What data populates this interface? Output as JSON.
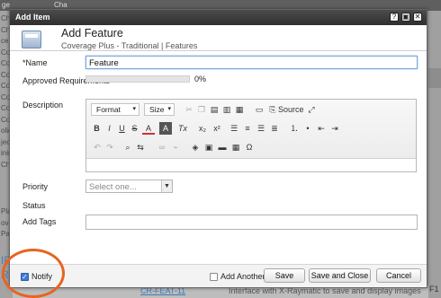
{
  "background": {
    "topbar_texts": [
      "ge",
      "Cha"
    ],
    "left_items": [
      "Cha",
      "Cha",
      "centt",
      "Cov",
      "Cov",
      "Cov",
      "Cov",
      "Cov",
      "Cov",
      "Cov",
      "olica",
      "ject",
      "inin",
      "Cha"
    ],
    "left_items_lower": [
      "Plan",
      "overa",
      "Pali"
    ],
    "left_blue": [
      "IP",
      "RF"
    ],
    "right_num": "F1",
    "bottom_link": "CR-FEAT-11",
    "bottom_text": "Interface with X-Raymatic to save and display images"
  },
  "dialog": {
    "window_title": "Add Item",
    "window_buttons": [
      "?",
      "▣",
      "✕"
    ],
    "title": "Add Feature",
    "subtitle": "Coverage Plus - Traditional | Features"
  },
  "form": {
    "name_label": "*Name",
    "name_value": "Feature",
    "approved_label": "Approved Requirements",
    "approved_value_text": "0%",
    "approved_fraction": 0,
    "description_label": "Description",
    "priority_label": "Priority",
    "priority_placeholder": "Select one...",
    "status_label": "Status",
    "tags_label": "Add Tags",
    "tags_value": ""
  },
  "editor": {
    "format_label": "Format",
    "size_label": "Size",
    "source_label": "Source",
    "row2": [
      "B",
      "I",
      "U",
      "S",
      "A",
      "A",
      "Tx"
    ],
    "subscript": "x₂",
    "superscript": "x²",
    "icons": [
      "cut-icon",
      "copy-icon",
      "paste-icon",
      "paste-text-icon",
      "paste-word-icon",
      "templates-icon",
      "source-icon",
      "maximize-icon",
      "align-left-icon",
      "align-center-icon",
      "align-right-icon",
      "justify-icon",
      "numbered-list-icon",
      "bullet-list-icon",
      "outdent-icon",
      "indent-icon",
      "undo-icon",
      "redo-icon",
      "find-icon",
      "replace-icon",
      "link-icon",
      "unlink-icon",
      "flash-icon",
      "image-icon",
      "folder-icon",
      "table-icon",
      "omega-icon"
    ],
    "omega": "Ω"
  },
  "footer": {
    "notify_label": "Notify",
    "notify_checked": true,
    "add_another_label": "Add Another",
    "add_another_checked": false,
    "save_label": "Save",
    "save_close_label": "Save and Close",
    "cancel_label": "Cancel"
  },
  "colors": {
    "titlebar": "#2f2f2f",
    "accent": "#3d7bd4",
    "highlight_ring": "#e8641f"
  }
}
